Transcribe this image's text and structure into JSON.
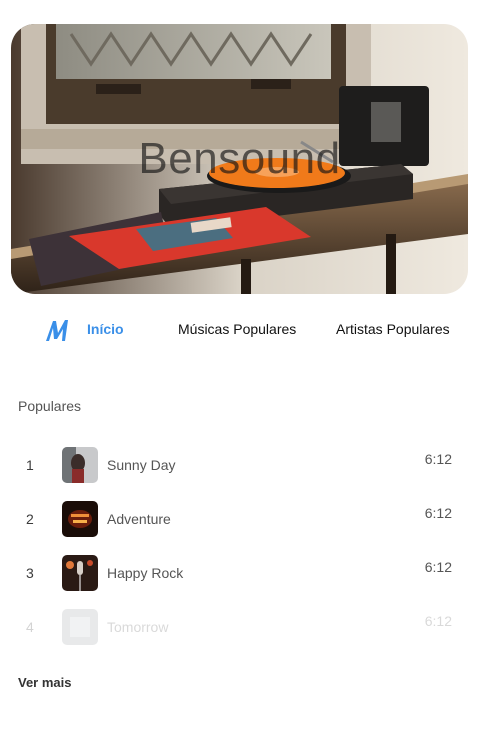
{
  "hero": {
    "title": "Bensound"
  },
  "nav": {
    "logo_icon": "m-logo-icon",
    "items": [
      {
        "label": "Início",
        "active": true
      },
      {
        "label": "Músicas Populares",
        "active": false
      },
      {
        "label": "Artistas Populares",
        "active": false
      }
    ]
  },
  "popular": {
    "heading": "Populares",
    "tracks": [
      {
        "rank": "1",
        "title": "Sunny Day",
        "duration": "6:12"
      },
      {
        "rank": "2",
        "title": "Adventure",
        "duration": "6:12"
      },
      {
        "rank": "3",
        "title": "Happy Rock",
        "duration": "6:12"
      },
      {
        "rank": "4",
        "title": "Tomorrow",
        "duration": "6:12"
      }
    ],
    "more_label": "Ver mais"
  },
  "colors": {
    "accent": "#3a8fe8",
    "vinyl": "#f07a1a",
    "album": "#d9382c"
  }
}
